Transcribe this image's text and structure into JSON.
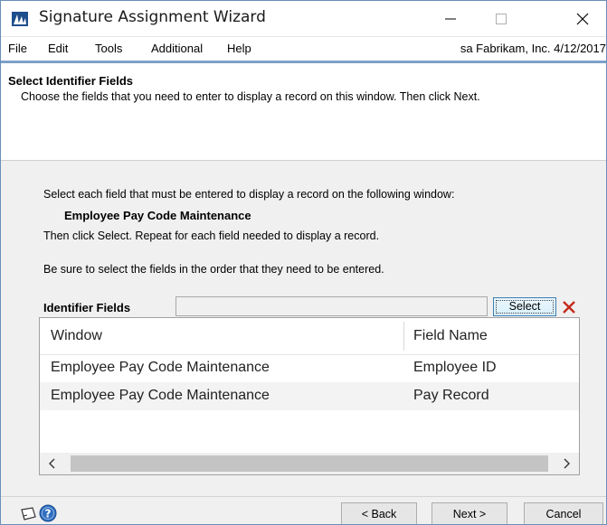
{
  "window": {
    "title": "Signature Assignment Wizard",
    "icons": {
      "app": "dynamics-logo-icon",
      "minimize": "minimize-icon",
      "maximize": "maximize-icon",
      "close": "close-icon"
    }
  },
  "menu": {
    "items": [
      "File",
      "Edit",
      "Tools",
      "Additional",
      "Help"
    ],
    "company_info": "sa  Fabrikam, Inc.  4/12/2017"
  },
  "header": {
    "title": "Select Identifier Fields",
    "description": "Choose the fields that you need to enter to display a record on this window. Then click Next."
  },
  "instructions": {
    "line1": "Select each field that must be entered to display a record on the following window:",
    "window_name": "Employee Pay Code Maintenance",
    "line2": "Then click Select.  Repeat for each field needed to display a record.",
    "line3": "Be sure to select the fields in the order that they need to be entered."
  },
  "identifier": {
    "label": "Identifier Fields",
    "input_value": "",
    "select_label": "Select",
    "delete_icon": "red-x-icon"
  },
  "list": {
    "columns": [
      "Window",
      "Field Name"
    ],
    "rows": [
      [
        "Employee Pay Code Maintenance",
        "Employee ID"
      ],
      [
        "Employee Pay Code Maintenance",
        "Pay Record"
      ]
    ]
  },
  "footer": {
    "back_label": "< Back",
    "next_label": "Next >",
    "cancel_label": "Cancel",
    "icons": [
      "note-icon",
      "help-icon"
    ]
  },
  "colors": {
    "accent": "#7da0c8",
    "select_border": "#3c7fb1",
    "delete_red": "#c42b1c",
    "help_blue": "#2f6fc0"
  }
}
